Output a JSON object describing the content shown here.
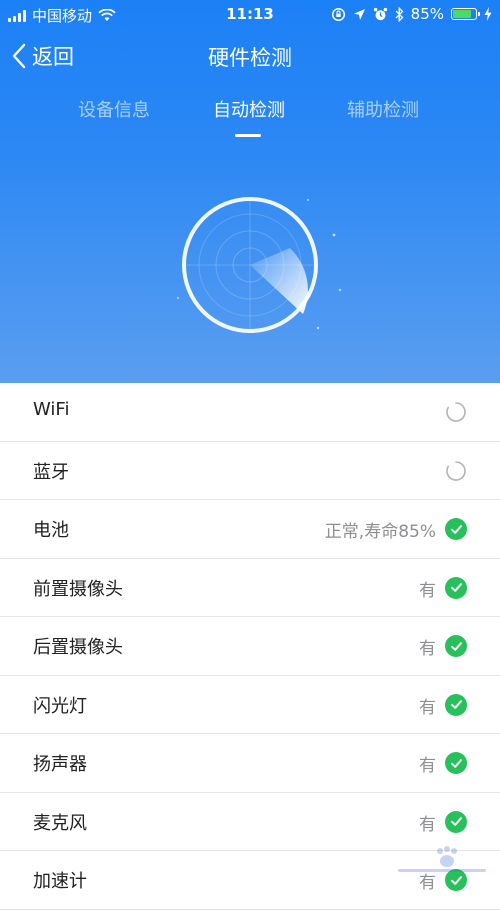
{
  "status_bar": {
    "carrier": "中国移动",
    "time": "11:13",
    "battery_text": "85%",
    "battery_level": 0.85,
    "icons": [
      "signal-icon",
      "wifi-icon",
      "lock-rotation-icon",
      "location-icon",
      "alarm-icon",
      "bluetooth-icon",
      "battery-icon",
      "charging-icon"
    ]
  },
  "nav": {
    "back_label": "返回",
    "title": "硬件检测"
  },
  "tabs": [
    {
      "label": "设备信息",
      "active": false
    },
    {
      "label": "自动检测",
      "active": true
    },
    {
      "label": "辅助检测",
      "active": false
    }
  ],
  "items": [
    {
      "label": "WiFi",
      "status": "",
      "icon": "loading-spinner-icon"
    },
    {
      "label": "蓝牙",
      "status": "",
      "icon": "loading-spinner-icon"
    },
    {
      "label": "电池",
      "status": "正常,寿命85%",
      "icon": "check-icon"
    },
    {
      "label": "前置摄像头",
      "status": "有",
      "icon": "check-icon"
    },
    {
      "label": "后置摄像头",
      "status": "有",
      "icon": "check-icon"
    },
    {
      "label": "闪光灯",
      "status": "有",
      "icon": "check-icon"
    },
    {
      "label": "扬声器",
      "status": "有",
      "icon": "check-icon"
    },
    {
      "label": "麦克风",
      "status": "有",
      "icon": "check-icon"
    },
    {
      "label": "加速计",
      "status": "有",
      "icon": "check-icon"
    }
  ],
  "colors": {
    "header_blue": "#1c80f6",
    "check_green": "#27c05a",
    "status_gray": "#8e8e93"
  }
}
